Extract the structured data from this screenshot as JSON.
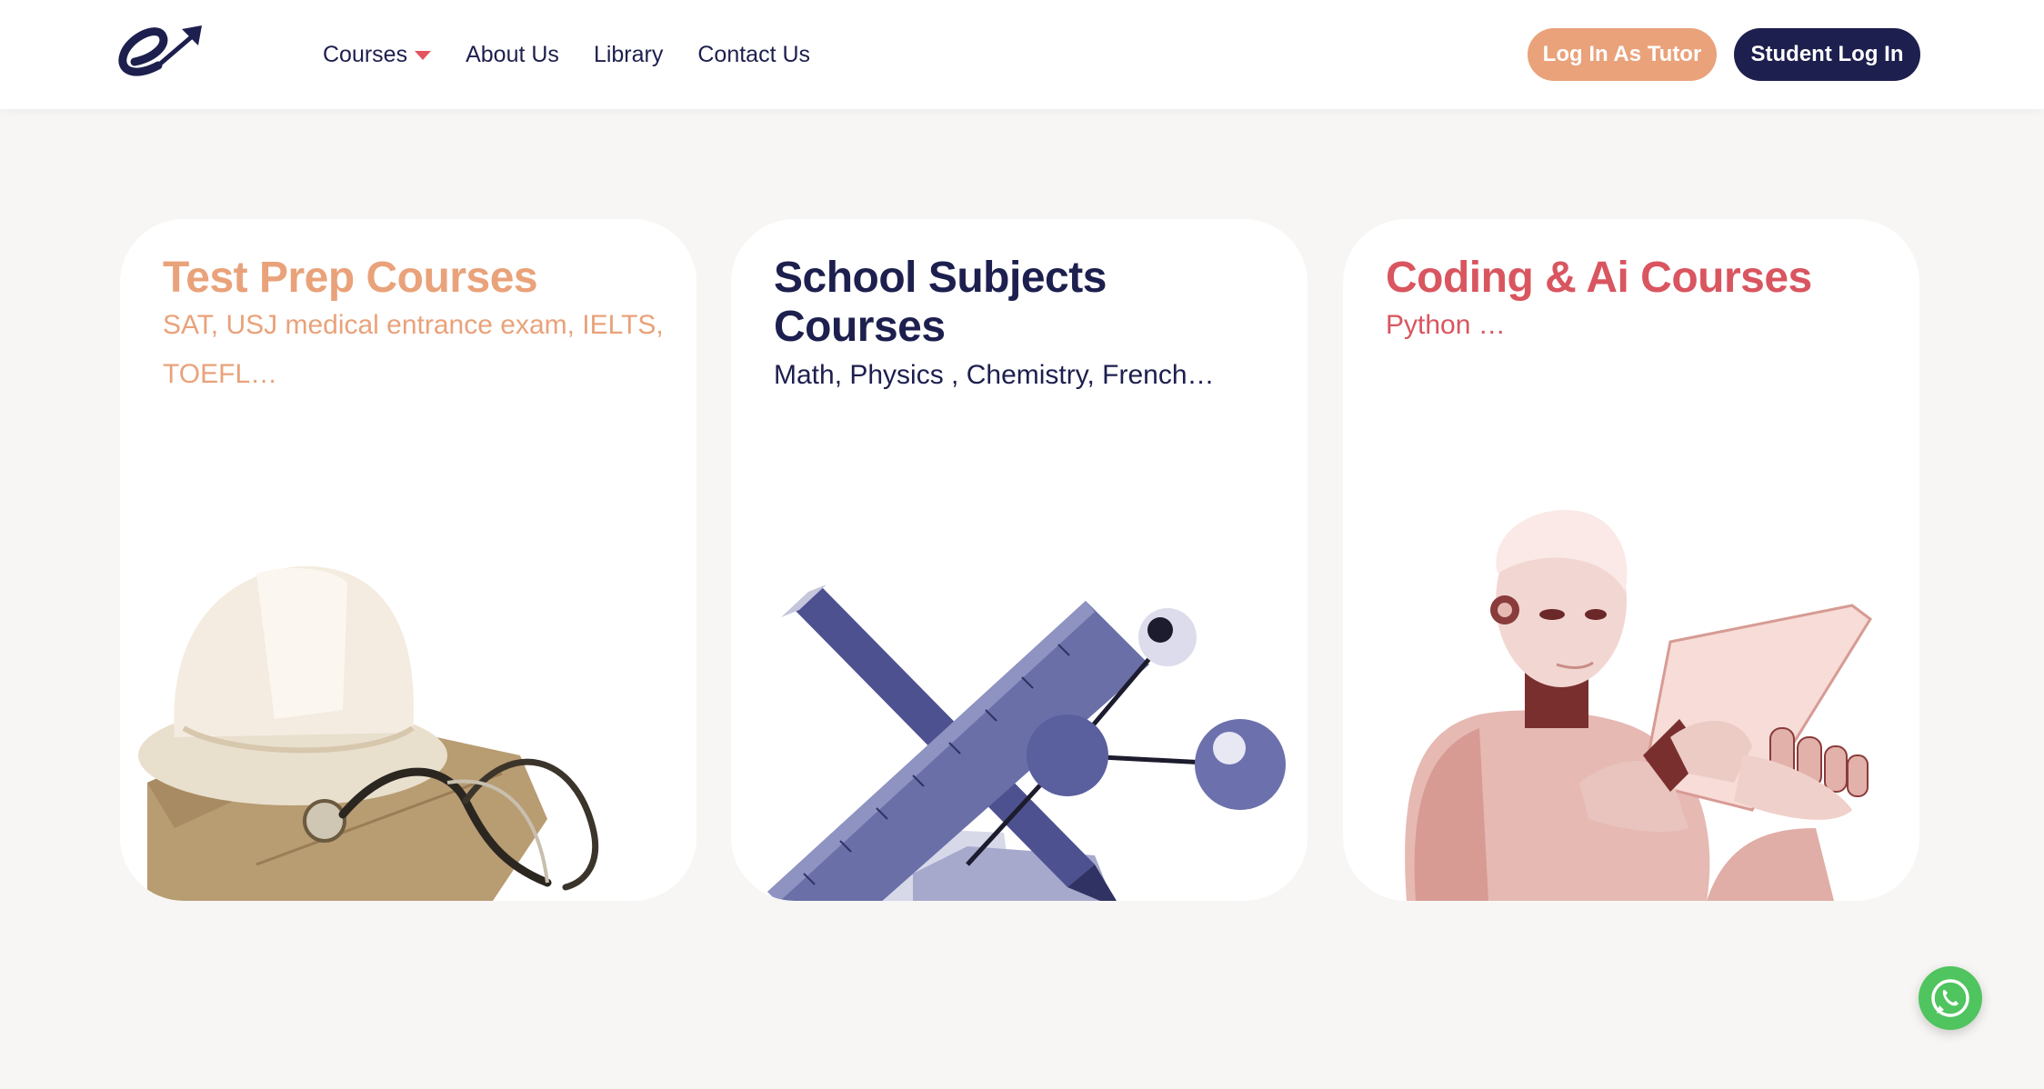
{
  "header": {
    "logo": {
      "icon": "brand-e-arrow-logo"
    },
    "nav": [
      {
        "label": "Courses",
        "has_dropdown": true
      },
      {
        "label": "About Us"
      },
      {
        "label": "Library"
      },
      {
        "label": "Contact Us"
      }
    ],
    "buttons": {
      "tutor_login": "Log In As Tutor",
      "student_login": "Student Log In"
    }
  },
  "cards": [
    {
      "title": "Test Prep Courses",
      "subtitle": "SAT, USJ medical entrance exam, IELTS, TOEFL…",
      "color": "#e9a27a",
      "image": "hard-hat-stethoscope-illustration"
    },
    {
      "title": "School Subjects Courses",
      "subtitle": "Math, Physics , Chemistry,  French…",
      "color": "#1d1f4e",
      "image": "ruler-pencil-molecule-illustration"
    },
    {
      "title": "Coding & Ai Courses",
      "subtitle": "Python …",
      "color": "#d9555f",
      "image": "robot-with-tablet-illustration"
    }
  ],
  "floating": {
    "icon": "whatsapp-icon"
  },
  "colors": {
    "navy": "#1d1f4e",
    "peach": "#e9a27a",
    "coral": "#d9555f",
    "background": "#f8f6f4",
    "whatsapp": "#4fc45f"
  }
}
